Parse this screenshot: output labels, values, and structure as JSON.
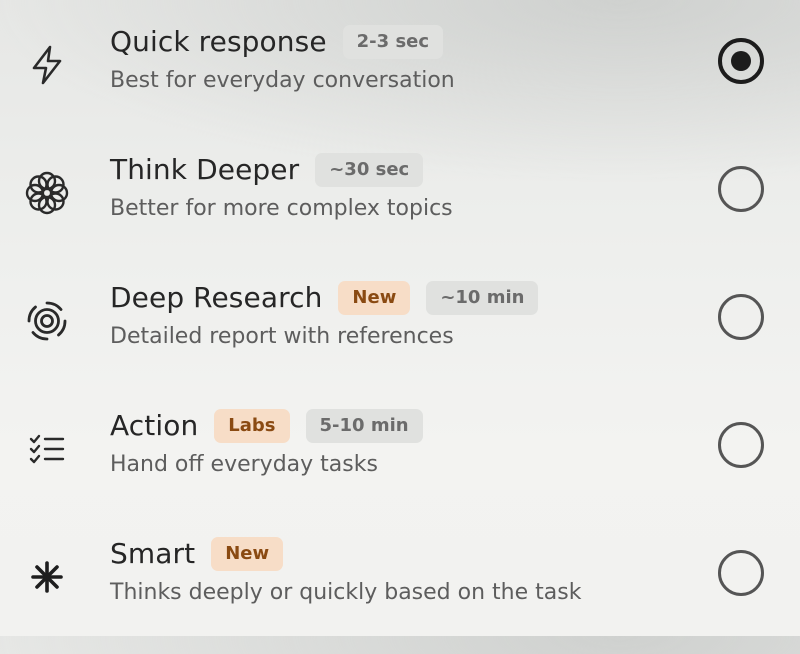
{
  "options": [
    {
      "title": "Quick response",
      "time": "2-3 sec",
      "description": "Best for everyday conversation",
      "icon": "lightning-icon",
      "selected": true
    },
    {
      "title": "Think Deeper",
      "time": "~30 sec",
      "description": "Better for more complex topics",
      "icon": "flower-icon",
      "selected": false
    },
    {
      "title": "Deep Research",
      "tag": "New",
      "time": "~10 min",
      "description": "Detailed report with references",
      "icon": "concentric-rings-icon",
      "selected": false
    },
    {
      "title": "Action",
      "tag": "Labs",
      "time": "5-10 min",
      "description": "Hand off everyday tasks",
      "icon": "checklist-icon",
      "selected": false
    },
    {
      "title": "Smart",
      "tag": "New",
      "description": "Thinks deeply or quickly based on the task",
      "icon": "asterisk-icon",
      "selected": false
    }
  ],
  "colors": {
    "tag_background": "#f7ddc7",
    "tag_text": "#8a4a12",
    "time_background": "#e0e1df",
    "time_text": "#6b6b6b",
    "radio_selected": "#1c1c1c"
  }
}
